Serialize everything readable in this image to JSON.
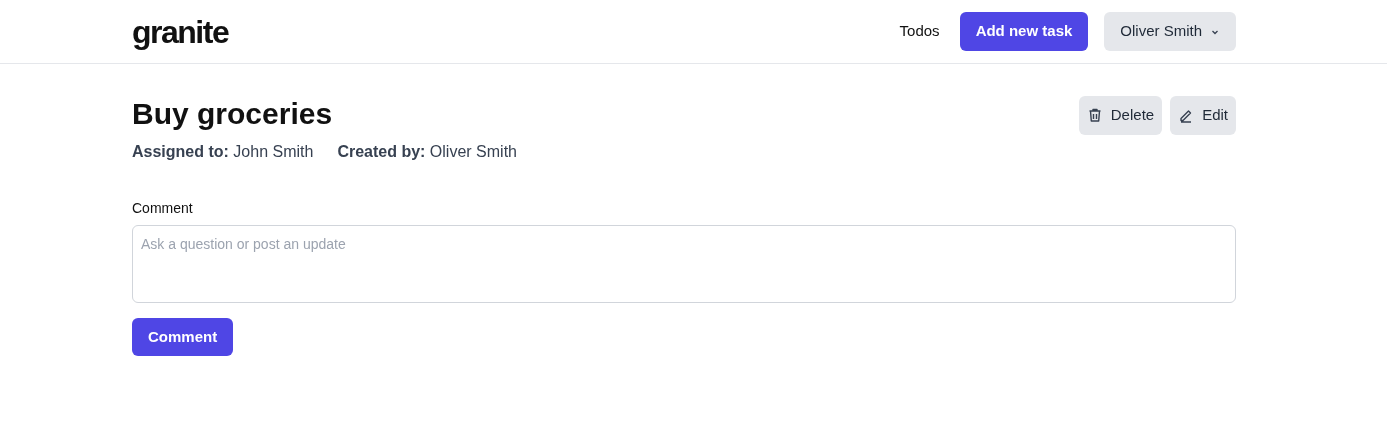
{
  "header": {
    "logo": "granite",
    "nav_link": "Todos",
    "add_button": "Add new task",
    "user_menu": "Oliver Smith"
  },
  "task": {
    "title": "Buy groceries",
    "actions": [
      {
        "kind": "delete",
        "label": "Delete"
      },
      {
        "kind": "edit",
        "label": "Edit"
      }
    ],
    "meta": [
      "**Assigned to:** John Smith",
      "**Created by:** Oliver Smith"
    ]
  },
  "comment_form": {
    "label": "Comment",
    "placeholder": "Ask a question or post an update",
    "submit": "Comment"
  }
}
